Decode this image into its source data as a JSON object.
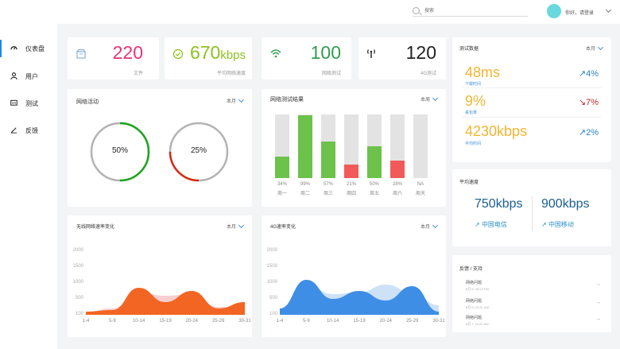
{
  "header": {
    "search_placeholder": "搜索",
    "greeting": "你好，请登录"
  },
  "sidebar": {
    "items": [
      {
        "label": "仪表盘",
        "icon": "dashboard-icon",
        "active": true
      },
      {
        "label": "用户",
        "icon": "user-icon",
        "active": false
      },
      {
        "label": "测试",
        "icon": "test-icon",
        "active": false
      },
      {
        "label": "反馈",
        "icon": "feedback-icon",
        "active": false
      }
    ]
  },
  "stats": [
    {
      "value": "220",
      "unit": "",
      "label": "文件",
      "color": "#e6337a",
      "icon": "file-icon"
    },
    {
      "value": "670",
      "unit": "kbps",
      "label": "平均网络速度",
      "color": "#8dc21f",
      "icon": "check-circle-icon"
    },
    {
      "value": "100",
      "unit": "",
      "label": "网络测试",
      "color": "#2e9e4f",
      "icon": "wifi-icon"
    },
    {
      "value": "120",
      "unit": "",
      "label": "4G测试",
      "color": "#222222",
      "icon": "antenna-icon"
    }
  ],
  "network_activity": {
    "title": "网络活动",
    "period": "本月",
    "rings": [
      {
        "label": "50%",
        "value": 50,
        "color": "#1ea51e"
      },
      {
        "label": "25%",
        "value": 25,
        "color": "#d62a14"
      }
    ]
  },
  "network_test": {
    "title": "网络测试结果",
    "period": "本周",
    "chart_data": {
      "type": "bar",
      "categories": [
        "周一",
        "周二",
        "周三",
        "周四",
        "周五",
        "周六",
        "周天"
      ],
      "labels": [
        "34%",
        "99%",
        "57%",
        "21%",
        "50%",
        "28%",
        "NA"
      ],
      "values": [
        34,
        99,
        57,
        21,
        50,
        28,
        0
      ],
      "colors": [
        "#6cc24a",
        "#6cc24a",
        "#6cc24a",
        "#f25a5a",
        "#6cc24a",
        "#f25a5a",
        "#6cc24a"
      ],
      "ylim": [
        0,
        100
      ]
    }
  },
  "test_data": {
    "title": "测试数据",
    "period": "本月",
    "metrics": [
      {
        "value": "48ms",
        "label": "下载时间",
        "change": "4%",
        "direction": "up",
        "value_color": "#f2b632",
        "label_color": "#3b8fd9",
        "change_color": "#2b7fc6"
      },
      {
        "value": "9%",
        "label": "丢包率",
        "change": "7%",
        "direction": "down",
        "value_color": "#f2b632",
        "label_color": "#3b8fd9",
        "change_color": "#c62828"
      },
      {
        "value": "4230kbps",
        "label": "平均时间",
        "change": "2%",
        "direction": "up",
        "value_color": "#f2b632",
        "label_color": "#3b8fd9",
        "change_color": "#2b7fc6"
      }
    ]
  },
  "avg_speed": {
    "title": "平均速度",
    "items": [
      {
        "value": "750kbps",
        "label": "中国电信"
      },
      {
        "value": "900kbps",
        "label": "中国移动"
      }
    ]
  },
  "wifi_chart": {
    "title": "无线网络速率变化",
    "period": "本月",
    "chart_data": {
      "type": "area",
      "x": [
        "1-4",
        "5-9",
        "10-14",
        "15-19",
        "20-24",
        "25-29",
        "30-31"
      ],
      "yticks": [
        "2000",
        "1500",
        "1000",
        "500",
        "100"
      ],
      "series": [
        {
          "values": [
            100,
            200,
            700,
            600,
            650,
            250,
            200
          ],
          "color": "#f8cfcf"
        },
        {
          "values": [
            100,
            150,
            850,
            400,
            750,
            200,
            400
          ],
          "color": "#f26522"
        }
      ],
      "ylim": [
        0,
        2000
      ]
    }
  },
  "g4_chart": {
    "title": "4G速率变化",
    "period": "本月",
    "chart_data": {
      "type": "area",
      "x": [
        "1-4",
        "5-9",
        "10-14",
        "15-19",
        "20-24",
        "25-29",
        "30-31"
      ],
      "yticks": [
        "2000",
        "1500",
        "1000",
        "500",
        "100"
      ],
      "series": [
        {
          "values": [
            100,
            950,
            650,
            700,
            950,
            700,
            300
          ],
          "color": "#cde1f7"
        },
        {
          "values": [
            200,
            1100,
            500,
            750,
            450,
            900,
            100
          ],
          "color": "#3e8ee6"
        }
      ],
      "ylim": [
        0,
        2000
      ]
    }
  },
  "feedback": {
    "title": "反馈 / 支持",
    "items": [
      {
        "title": "网络问题",
        "time": "8月 5, 16:22 PM"
      },
      {
        "title": "网络问题",
        "time": "8月 6, 10:31 AM"
      },
      {
        "title": "网络问题",
        "time": "8月 7, 11:20 AM"
      }
    ]
  }
}
